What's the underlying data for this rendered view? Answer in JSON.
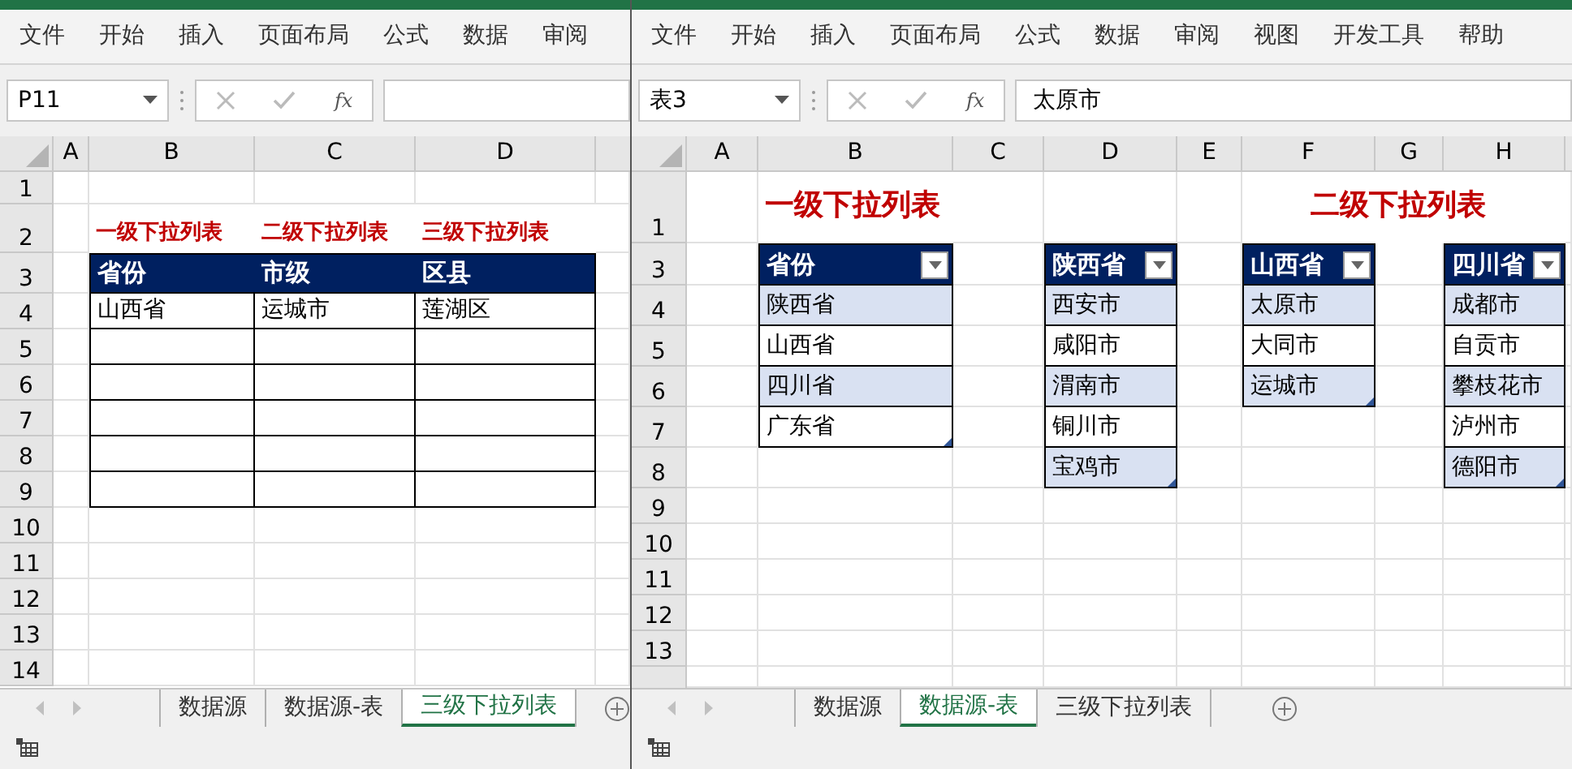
{
  "windows": [
    {
      "menu": [
        "文件",
        "开始",
        "插入",
        "页面布局",
        "公式",
        "数据",
        "审阅"
      ],
      "name_box": "P11",
      "function_label": "fx",
      "columns": [
        "A",
        "B",
        "C",
        "D"
      ],
      "rows": [
        "1",
        "2",
        "3",
        "4",
        "5",
        "6",
        "7",
        "8",
        "9",
        "10",
        "11",
        "12",
        "13",
        "14"
      ],
      "titles": [
        "一级下拉列表",
        "二级下拉列表",
        "三级下拉列表"
      ],
      "tables": [
        {
          "filter_buttons": false,
          "banded": false,
          "header": [
            "省份",
            "市级",
            "区县"
          ],
          "rows": [
            [
              "山西省",
              "运城市",
              "莲湖区"
            ]
          ]
        }
      ],
      "sheet_tabs": [
        {
          "label": "数据源",
          "selected": false
        },
        {
          "label": "数据源-表",
          "selected": false
        },
        {
          "label": "三级下拉列表",
          "selected": true
        }
      ]
    },
    {
      "menu": [
        "文件",
        "开始",
        "插入",
        "页面布局",
        "公式",
        "数据",
        "审阅",
        "视图",
        "开发工具",
        "帮助"
      ],
      "name_box": "表3",
      "function_label": "fx",
      "formula": "太原市",
      "columns": [
        "A",
        "B",
        "C",
        "D",
        "E",
        "F",
        "G",
        "H"
      ],
      "rows": [
        "1",
        "3",
        "4",
        "5",
        "6",
        "7",
        "8",
        "9",
        "10",
        "11",
        "12",
        "13"
      ],
      "titles": [
        "一级下拉列表",
        "二级下拉列表"
      ],
      "tables": [
        {
          "filter_buttons": true,
          "banded": true,
          "header": [
            "省份"
          ],
          "rows": [
            [
              "陕西省"
            ],
            [
              "山西省"
            ],
            [
              "四川省"
            ],
            [
              "广东省"
            ]
          ]
        },
        {
          "filter_buttons": true,
          "banded": true,
          "header": [
            "陕西省"
          ],
          "rows": [
            [
              "西安市"
            ],
            [
              "咸阳市"
            ],
            [
              "渭南市"
            ],
            [
              "铜川市"
            ],
            [
              "宝鸡市"
            ]
          ]
        },
        {
          "filter_buttons": true,
          "banded": true,
          "header": [
            "山西省"
          ],
          "rows": [
            [
              "太原市"
            ],
            [
              "大同市"
            ],
            [
              "运城市"
            ]
          ]
        },
        {
          "filter_buttons": true,
          "banded": true,
          "header": [
            "四川省"
          ],
          "rows": [
            [
              "成都市"
            ],
            [
              "自贡市"
            ],
            [
              "攀枝花市"
            ],
            [
              "泸州市"
            ],
            [
              "德阳市"
            ]
          ]
        }
      ],
      "sheet_tabs": [
        {
          "label": "数据源",
          "selected": false
        },
        {
          "label": "数据源-表",
          "selected": true
        },
        {
          "label": "三级下拉列表",
          "selected": false
        }
      ]
    }
  ]
}
